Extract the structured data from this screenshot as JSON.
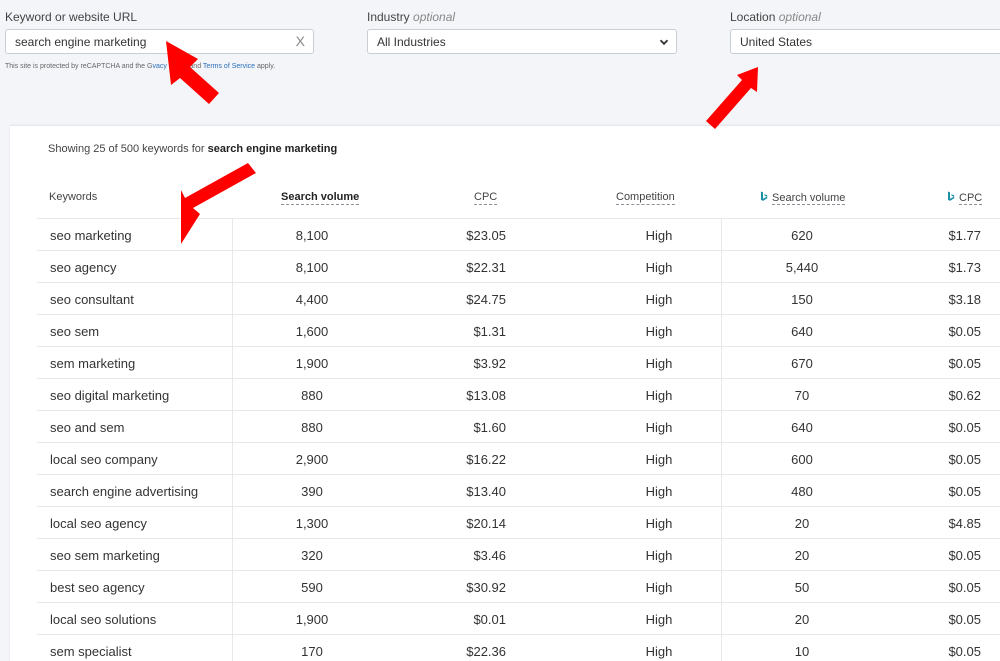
{
  "search": {
    "keyword_label": "Keyword or website URL",
    "keyword_value": "search engine marketing",
    "clear_glyph": "X",
    "industry_label": "Industry",
    "industry_optional": "optional",
    "industry_value": "All Industries",
    "location_label": "Location",
    "location_optional": "optional",
    "location_value": "United States",
    "recaptcha_prefix": "This site is protected by reCAPTCHA and the G",
    "privacy_link": "vacy Policy",
    "recaptcha_mid": " and ",
    "terms_link": "Terms of Service",
    "recaptcha_suffix": " apply."
  },
  "results": {
    "showing_prefix": "Showing 25 of 500 keywords for ",
    "showing_query": "search engine marketing",
    "headers": {
      "keywords": "Keywords",
      "search_volume": "Search volume",
      "cpc": "CPC",
      "competition": "Competition",
      "bing_search_volume": "Search volume",
      "bing_cpc": "CPC"
    },
    "rows": [
      {
        "keyword": "seo marketing",
        "volume": "8,100",
        "cpc": "$23.05",
        "competition": "High",
        "bing_volume": "620",
        "bing_cpc": "$1.77"
      },
      {
        "keyword": "seo agency",
        "volume": "8,100",
        "cpc": "$22.31",
        "competition": "High",
        "bing_volume": "5,440",
        "bing_cpc": "$1.73"
      },
      {
        "keyword": "seo consultant",
        "volume": "4,400",
        "cpc": "$24.75",
        "competition": "High",
        "bing_volume": "150",
        "bing_cpc": "$3.18"
      },
      {
        "keyword": "seo sem",
        "volume": "1,600",
        "cpc": "$1.31",
        "competition": "High",
        "bing_volume": "640",
        "bing_cpc": "$0.05"
      },
      {
        "keyword": "sem marketing",
        "volume": "1,900",
        "cpc": "$3.92",
        "competition": "High",
        "bing_volume": "670",
        "bing_cpc": "$0.05"
      },
      {
        "keyword": "seo digital marketing",
        "volume": "880",
        "cpc": "$13.08",
        "competition": "High",
        "bing_volume": "70",
        "bing_cpc": "$0.62"
      },
      {
        "keyword": "seo and sem",
        "volume": "880",
        "cpc": "$1.60",
        "competition": "High",
        "bing_volume": "640",
        "bing_cpc": "$0.05"
      },
      {
        "keyword": "local seo company",
        "volume": "2,900",
        "cpc": "$16.22",
        "competition": "High",
        "bing_volume": "600",
        "bing_cpc": "$0.05"
      },
      {
        "keyword": "search engine advertising",
        "volume": "390",
        "cpc": "$13.40",
        "competition": "High",
        "bing_volume": "480",
        "bing_cpc": "$0.05"
      },
      {
        "keyword": "local seo agency",
        "volume": "1,300",
        "cpc": "$20.14",
        "competition": "High",
        "bing_volume": "20",
        "bing_cpc": "$4.85"
      },
      {
        "keyword": "seo sem marketing",
        "volume": "320",
        "cpc": "$3.46",
        "competition": "High",
        "bing_volume": "20",
        "bing_cpc": "$0.05"
      },
      {
        "keyword": "best seo agency",
        "volume": "590",
        "cpc": "$30.92",
        "competition": "High",
        "bing_volume": "50",
        "bing_cpc": "$0.05"
      },
      {
        "keyword": "local seo solutions",
        "volume": "1,900",
        "cpc": "$0.01",
        "competition": "High",
        "bing_volume": "20",
        "bing_cpc": "$0.05"
      },
      {
        "keyword": "sem specialist",
        "volume": "170",
        "cpc": "$22.36",
        "competition": "High",
        "bing_volume": "10",
        "bing_cpc": "$0.05"
      }
    ]
  },
  "colors": {
    "accent_link": "#2a6ebb",
    "bing_icon": "#1a8fa6",
    "annotation_arrow": "#ff0000"
  },
  "icons": {
    "clear": "close-icon",
    "select_caret": "chevron-down-icon",
    "bing": "bing-icon",
    "annotation": "red-arrow-icon"
  }
}
